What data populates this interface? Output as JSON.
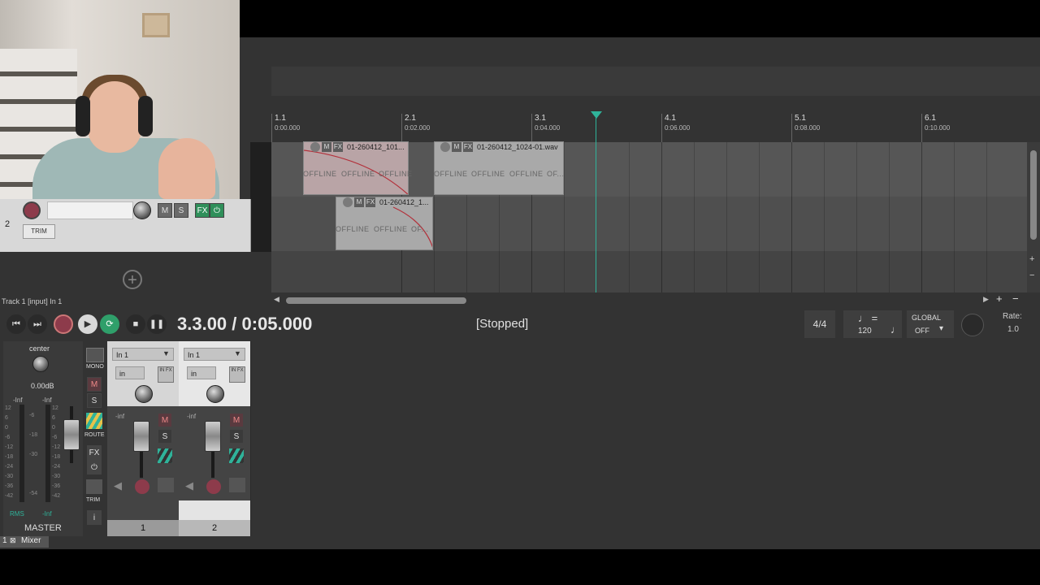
{
  "webcam": {
    "label": ""
  },
  "tcp": {
    "track_number": "2",
    "trim_label": "TRIM",
    "mute_label": "M",
    "solo_label": "S",
    "fx_label": "FX"
  },
  "ruler": {
    "marks": [
      {
        "bar": "1.1",
        "time": "0:00.000"
      },
      {
        "bar": "2.1",
        "time": "0:02.000"
      },
      {
        "bar": "3.1",
        "time": "0:04.000"
      },
      {
        "bar": "4.1",
        "time": "0:06.000"
      },
      {
        "bar": "5.1",
        "time": "0:08.000"
      },
      {
        "bar": "6.1",
        "time": "0:10.000"
      }
    ]
  },
  "items": {
    "item1_name": "01-260412_101...",
    "item2_name": "01-260412_1024-01.wav",
    "item3_name": "01-260412_1...",
    "offline_label": "OFFLINE",
    "offline_short": "OF...",
    "offline_short2": "OF...",
    "m_label": "M",
    "fx_label": "FX"
  },
  "status_bar": {
    "track_info": "Track 1 [input] In 1"
  },
  "transport": {
    "time": "3.3.00 / 0:05.000",
    "status": "[Stopped]",
    "time_signature": "4/4",
    "tempo": "120",
    "global_label": "GLOBAL",
    "global_value": "OFF",
    "rate_label": "Rate:",
    "rate_value": "1.0"
  },
  "mixer": {
    "master": {
      "pan": "center",
      "volume": "0.00dB",
      "left_peak": "-Inf",
      "right_peak": "-Inf",
      "rms_label": "RMS",
      "rms_value": "-Inf",
      "name": "MASTER",
      "mono_label": "MONO",
      "route_label": "ROUTE",
      "fx_label": "FX",
      "trim_label": "TRIM",
      "m_label": "M",
      "s_label": "S",
      "scale_left": [
        "12",
        "6",
        "0",
        "-6",
        "-12",
        "-18",
        "-24",
        "-30",
        "-36",
        "-42"
      ],
      "scale_mid": [
        "-6",
        "-18",
        "-30",
        "-54"
      ],
      "scale_right": [
        "12",
        "6",
        "0",
        "-6",
        "-12",
        "-18",
        "-24",
        "-30",
        "-36",
        "-42"
      ]
    },
    "channels": [
      {
        "input": "In 1",
        "mode": "in",
        "fx_label": "IN FX",
        "peak": "-inf",
        "m_label": "M",
        "s_label": "S",
        "number": "1"
      },
      {
        "input": "In 1",
        "mode": "in",
        "fx_label": "IN FX",
        "peak": "-inf",
        "m_label": "M",
        "s_label": "S",
        "number": "2"
      }
    ],
    "tab_label": "Mixer",
    "tab_number": "1"
  },
  "colors": {
    "accent": "#2fb39a",
    "rec": "#8d3b4b",
    "fx_on": "#2f8f5a"
  }
}
